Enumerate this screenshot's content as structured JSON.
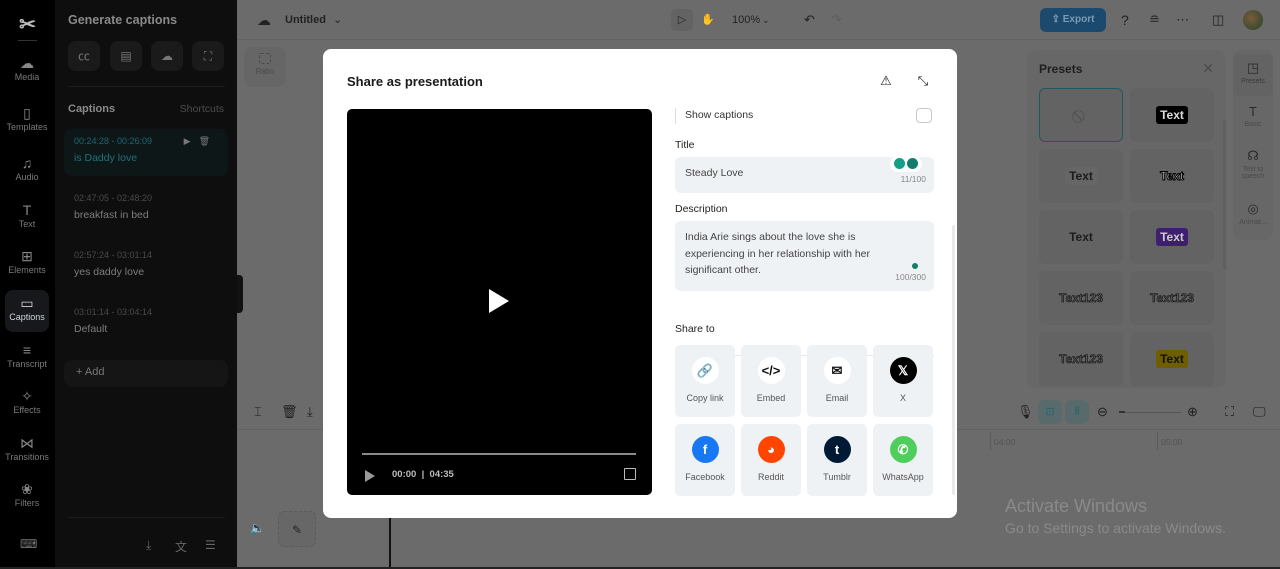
{
  "rail": {
    "logo": "CapCut",
    "items": [
      {
        "label": "Media",
        "icon": "cloud-upload-icon",
        "glyph": "☁"
      },
      {
        "label": "Templates",
        "icon": "templates-icon",
        "glyph": "▯"
      },
      {
        "label": "Audio",
        "icon": "music-note-icon",
        "glyph": "♫"
      },
      {
        "label": "Text",
        "icon": "text-icon",
        "glyph": "T"
      },
      {
        "label": "Elements",
        "icon": "elements-icon",
        "glyph": "⊞"
      },
      {
        "label": "Captions",
        "icon": "captions-icon",
        "glyph": "▭",
        "active": true
      },
      {
        "label": "Transcript",
        "icon": "transcript-icon",
        "glyph": "≡"
      },
      {
        "label": "Effects",
        "icon": "effects-icon",
        "glyph": "✧"
      },
      {
        "label": "Transitions",
        "icon": "transitions-icon",
        "glyph": "⋈"
      },
      {
        "label": "Filters",
        "icon": "filters-icon",
        "glyph": "❀"
      }
    ],
    "bottom_icon": "keyboard-icon"
  },
  "captions_panel": {
    "title": "Generate captions",
    "gen_buttons": [
      "cc-icon",
      "subtitle-icon",
      "cloud-upload-icon",
      "scan-audio-icon"
    ],
    "section_label": "Captions",
    "shortcuts_label": "Shortcuts",
    "items": [
      {
        "time": "00:24:28 - 00:26:09",
        "text": "is Daddy love",
        "active": true
      },
      {
        "time": "02:47:05 - 02:48:20",
        "text": "breakfast in bed"
      },
      {
        "time": "02:57:24 - 03:01:14",
        "text": "yes daddy love"
      },
      {
        "time": "03:01:14 - 03:04:14",
        "text": "Default"
      }
    ],
    "add_label": "+ Add",
    "bottom_icons": [
      "download-icon",
      "translate-icon",
      "search-list-icon"
    ]
  },
  "topbar": {
    "project_name": "Untitled",
    "zoom": "100%",
    "export_label": "Export"
  },
  "canvas": {
    "ratio_label": "Ratio"
  },
  "presets": {
    "title": "Presets",
    "items": [
      {
        "label": "",
        "style": "none"
      },
      {
        "label": "Text",
        "style": "black-bg"
      },
      {
        "label": "Text",
        "style": "light-bg"
      },
      {
        "label": "Text",
        "style": "outlined"
      },
      {
        "label": "Text",
        "style": "plain"
      },
      {
        "label": "Text",
        "style": "purple-bg"
      },
      {
        "label": "Text123",
        "style": "green-digits"
      },
      {
        "label": "Text123",
        "style": "purple-digit"
      },
      {
        "label": "Text123",
        "style": "shadow"
      },
      {
        "label": "Text",
        "style": "yellow-bg"
      }
    ],
    "tabs": [
      {
        "label": "Presets",
        "glyph": "◳",
        "active": true
      },
      {
        "label": "Basic",
        "glyph": "T"
      },
      {
        "label": "Text to speech",
        "glyph": "☊"
      },
      {
        "label": "Animat...",
        "glyph": "◎"
      }
    ]
  },
  "timeline": {
    "ruler_labels": [
      "04:00",
      "05:00"
    ]
  },
  "modal": {
    "title": "Share as presentation",
    "video": {
      "current": "00:00",
      "separator": "|",
      "duration": "04:35"
    },
    "show_captions_label": "Show captions",
    "show_captions_checked": false,
    "title_label": "Title",
    "title_value": "Steady Love",
    "title_counter": "11/100",
    "description_label": "Description",
    "description_value": "India Arie sings about the love she is experiencing in her relationship with her significant other.",
    "description_counter": "100/300",
    "share_label": "Share to",
    "share_targets": [
      {
        "label": "Copy link",
        "icon": "link-icon",
        "glyph": "🔗",
        "bg": "#ffffff",
        "fg": "#111111"
      },
      {
        "label": "Embed",
        "icon": "code-icon",
        "glyph": "</>",
        "bg": "#ffffff",
        "fg": "#111111"
      },
      {
        "label": "Email",
        "icon": "email-icon",
        "glyph": "✉",
        "bg": "#ffffff",
        "fg": "#111111"
      },
      {
        "label": "X",
        "icon": "x-logo-icon",
        "glyph": "𝕏",
        "bg": "#000000",
        "fg": "#ffffff"
      },
      {
        "label": "Facebook",
        "icon": "facebook-icon",
        "glyph": "f",
        "bg": "#1877f2",
        "fg": "#ffffff"
      },
      {
        "label": "Reddit",
        "icon": "reddit-icon",
        "glyph": "◕",
        "bg": "#ff4500",
        "fg": "#ffffff"
      },
      {
        "label": "Tumblr",
        "icon": "tumblr-icon",
        "glyph": "t",
        "bg": "#001935",
        "fg": "#ffffff"
      },
      {
        "label": "WhatsApp",
        "icon": "whatsapp-icon",
        "glyph": "✆",
        "bg": "#4fce5d",
        "fg": "#ffffff"
      }
    ]
  },
  "watermark": {
    "line1": "Activate Windows",
    "line2": "Go to Settings to activate Windows."
  }
}
